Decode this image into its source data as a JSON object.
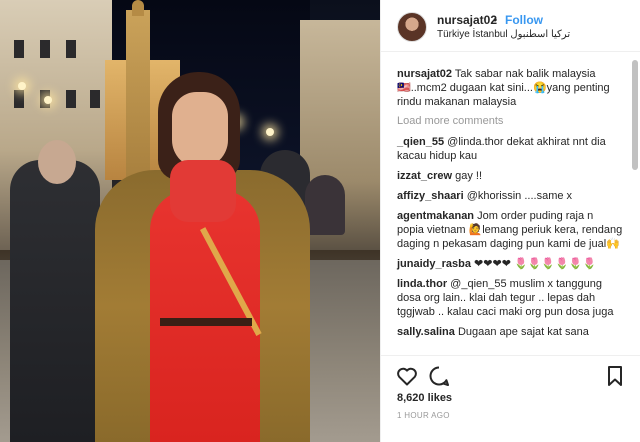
{
  "post": {
    "username": "nursajat02",
    "follow_label": "Follow",
    "separator": "•",
    "location": "Türkiye İstanbul تركيا اسطنبول",
    "likes": "8,620 likes",
    "time": "1 HOUR AGO"
  },
  "caption": {
    "username": "nursajat02",
    "text": "Tak sabar nak balik malaysia 🇲🇾..mcm2 dugaan kat sini...😭yang penting rindu makanan malaysia"
  },
  "load_more": "Load more comments",
  "comments": [
    {
      "username": "_qien_55",
      "text": "@linda.thor dekat akhirat nnt dia kacau hidup kau"
    },
    {
      "username": "izzat_crew",
      "text": "gay !!"
    },
    {
      "username": "affizy_shaari",
      "text": "@khorissin ....same x"
    },
    {
      "username": "agentmakanan",
      "text": "Jom order puding raja n popia vietnam 🙋lemang periuk kera, rendang daging n pekasam daging pun kami de jual🙌"
    },
    {
      "username": "junaidy_rasba",
      "text": "❤❤❤❤ 🌷🌷🌷🌷🌷🌷"
    },
    {
      "username": "linda.thor",
      "text": "@_qien_55 muslim x tanggung dosa org lain.. klai dah tegur .. lepas dah tggjwab .. kalau caci maki org pun dosa juga"
    },
    {
      "username": "sally.salina",
      "text": "Dugaan ape sajat kat sana"
    }
  ],
  "icons": {
    "like": "heart-icon",
    "comment": "comment-icon",
    "save": "bookmark-icon"
  },
  "colors": {
    "link_blue": "#3897f0",
    "text": "#262626",
    "muted": "#999999"
  }
}
